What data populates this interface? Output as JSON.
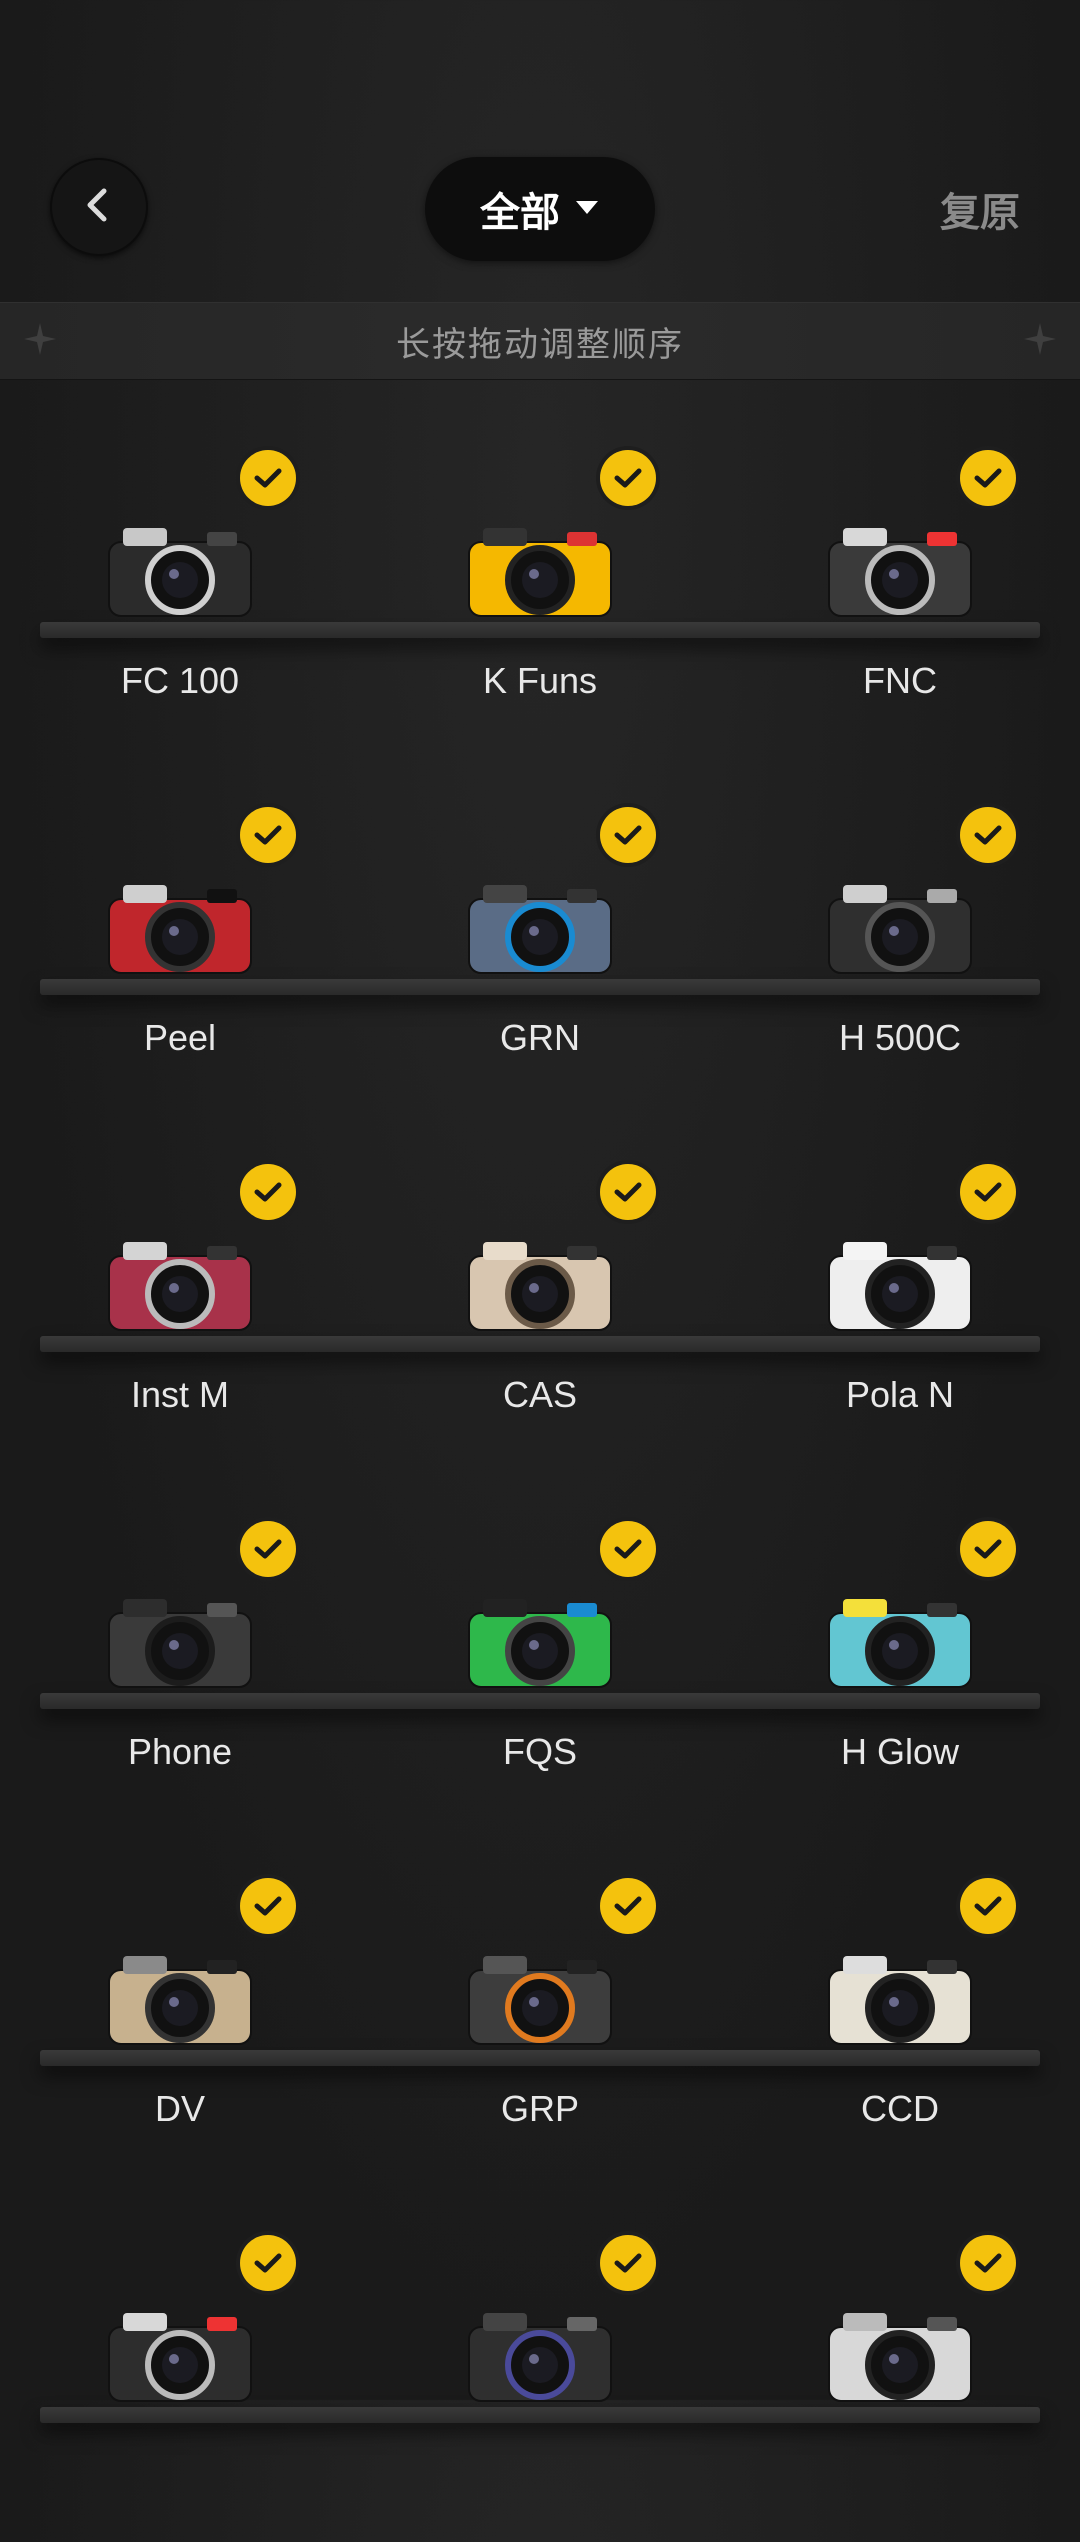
{
  "header": {
    "back_icon": "chevron-left-icon",
    "filter_label": "全部",
    "filter_icon": "caret-down-icon",
    "reset_label": "复原"
  },
  "hint": {
    "text": "长按拖动调整顺序",
    "icon": "sparkle-icon"
  },
  "colors": {
    "accent": "#f4c20d",
    "background": "#1c1c1c"
  },
  "cameras": [
    {
      "label": "FC 100",
      "icon": "camera-fc100-icon",
      "selected": true
    },
    {
      "label": "K Funs",
      "icon": "camera-kfuns-icon",
      "selected": true
    },
    {
      "label": "FNC",
      "icon": "camera-fnc-icon",
      "selected": true
    },
    {
      "label": "Peel",
      "icon": "camera-peel-icon",
      "selected": true
    },
    {
      "label": "GRN",
      "icon": "camera-grn-icon",
      "selected": true
    },
    {
      "label": "H 500C",
      "icon": "camera-h500c-icon",
      "selected": true
    },
    {
      "label": "Inst M",
      "icon": "camera-instm-icon",
      "selected": true
    },
    {
      "label": "CAS",
      "icon": "camera-cas-icon",
      "selected": true
    },
    {
      "label": "Pola N",
      "icon": "camera-polan-icon",
      "selected": true
    },
    {
      "label": "Phone",
      "icon": "camera-phone-icon",
      "selected": true
    },
    {
      "label": "FQS",
      "icon": "camera-fqs-icon",
      "selected": true
    },
    {
      "label": "H Glow",
      "icon": "camera-hglow-icon",
      "selected": true
    },
    {
      "label": "DV",
      "icon": "camera-dv-icon",
      "selected": true
    },
    {
      "label": "GRP",
      "icon": "camera-grp-icon",
      "selected": true
    },
    {
      "label": "CCD",
      "icon": "camera-ccd-icon",
      "selected": true
    },
    {
      "label": "",
      "icon": "camera-icon",
      "selected": true
    },
    {
      "label": "",
      "icon": "camera-icon",
      "selected": true
    },
    {
      "label": "",
      "icon": "camera-icon",
      "selected": true
    }
  ]
}
